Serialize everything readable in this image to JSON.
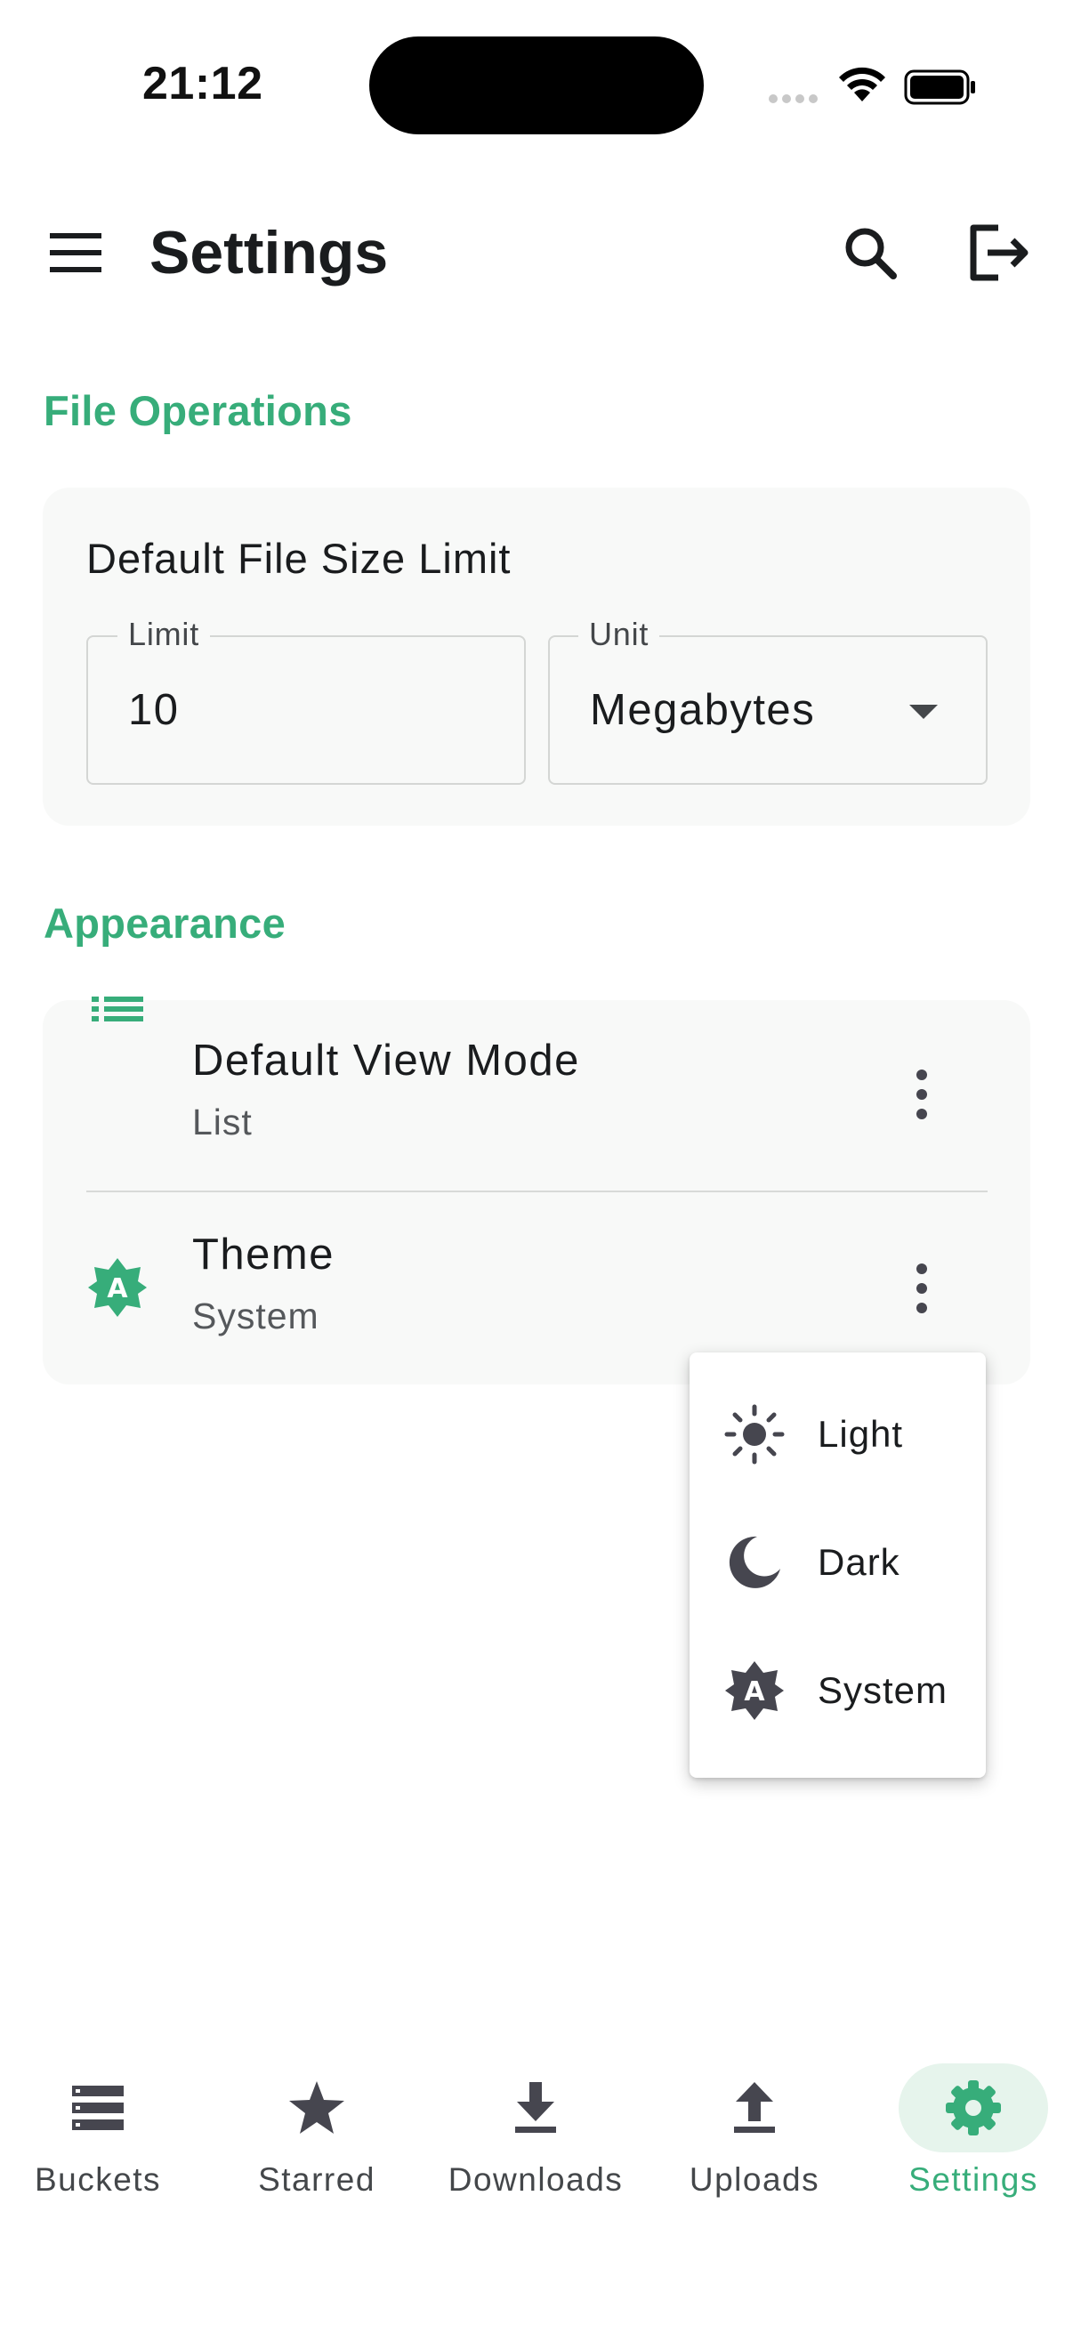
{
  "status_bar": {
    "time": "21:12"
  },
  "app_bar": {
    "title": "Settings"
  },
  "sections": {
    "file_operations": {
      "header": "File Operations",
      "card_title": "Default File Size Limit",
      "limit": {
        "label": "Limit",
        "value": "10"
      },
      "unit": {
        "label": "Unit",
        "value": "Megabytes"
      }
    },
    "appearance": {
      "header": "Appearance",
      "view_mode": {
        "title": "Default View Mode",
        "subtitle": "List",
        "icon": "list-icon"
      },
      "theme": {
        "title": "Theme",
        "subtitle": "System",
        "icon": "brightness-auto-icon"
      }
    }
  },
  "theme_menu": {
    "items": [
      {
        "label": "Light",
        "icon": "sun-icon"
      },
      {
        "label": "Dark",
        "icon": "moon-icon"
      },
      {
        "label": "System",
        "icon": "brightness-auto-icon"
      }
    ]
  },
  "bottom_nav": {
    "items": [
      {
        "label": "Buckets",
        "icon": "storage-icon"
      },
      {
        "label": "Starred",
        "icon": "star-icon"
      },
      {
        "label": "Downloads",
        "icon": "download-icon"
      },
      {
        "label": "Uploads",
        "icon": "upload-icon"
      },
      {
        "label": "Settings",
        "icon": "gear-icon",
        "active": true
      }
    ]
  },
  "colors": {
    "accent": "#37ad7a",
    "accent_container": "#e6f4ec",
    "icon": "#46464f"
  }
}
